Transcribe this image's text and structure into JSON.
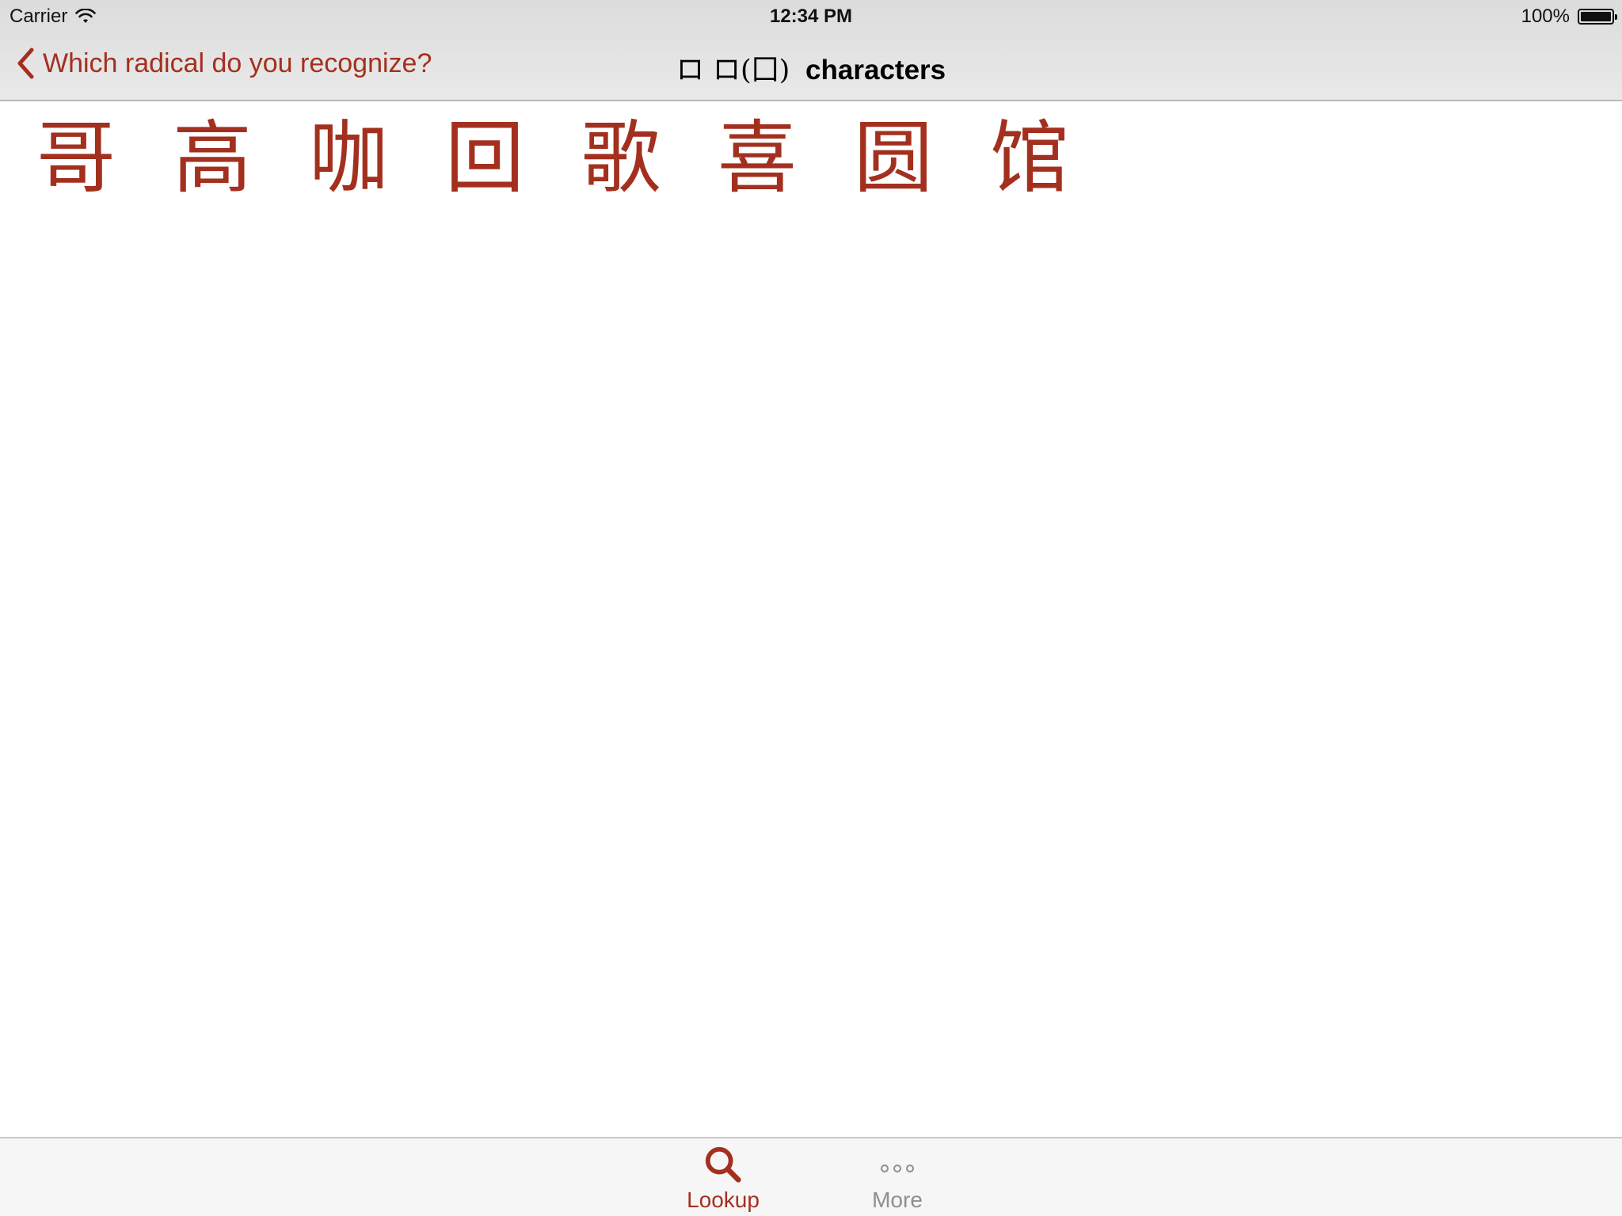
{
  "status_bar": {
    "carrier": "Carrier",
    "time": "12:34 PM",
    "battery": "100%"
  },
  "nav": {
    "back_label": "Which radical do you recognize?",
    "title_radical": "ロ ロ(囗)",
    "title_label": "characters"
  },
  "characters": [
    "哥",
    "高",
    "咖",
    "回",
    "歌",
    "喜",
    "圆",
    "馆"
  ],
  "tabs": [
    {
      "label": "Lookup",
      "icon": "search-icon",
      "selected": true
    },
    {
      "label": "More",
      "icon": "more-icon",
      "selected": false
    }
  ],
  "colors": {
    "accent": "#a3301f",
    "inactive": "#8e8e93"
  }
}
